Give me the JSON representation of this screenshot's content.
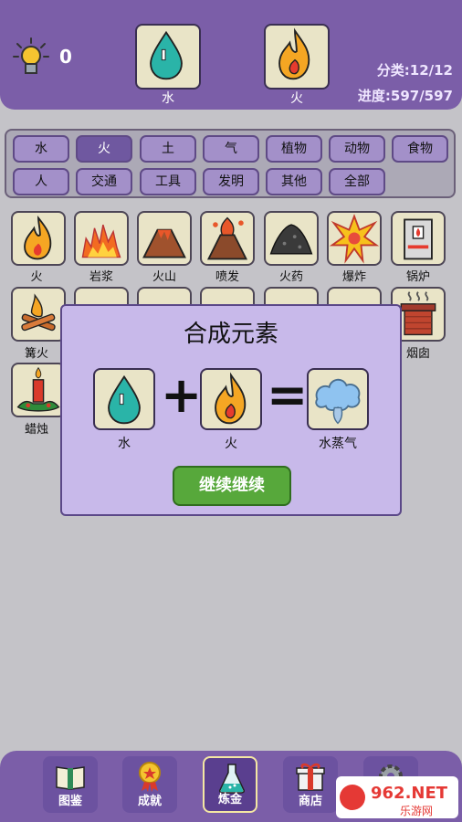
{
  "top": {
    "hint_count": "0",
    "slot_left_label": "水",
    "slot_right_label": "火",
    "category_stat": "分类:12/12",
    "progress_stat": "进度:597/597"
  },
  "categories": [
    "水",
    "火",
    "土",
    "气",
    "植物",
    "动物",
    "食物",
    "人",
    "交通",
    "工具",
    "发明",
    "其他",
    "全部"
  ],
  "elements": [
    "火",
    "岩浆",
    "火山",
    "喷发",
    "火药",
    "爆炸",
    "锅炉",
    "篝火",
    "",
    "",
    "",
    "",
    "",
    "烟囱",
    "蜡烛"
  ],
  "modal": {
    "title": "合成元素",
    "input_a": "水",
    "input_b": "火",
    "result": "水蒸气",
    "plus": "+",
    "equals": "=",
    "continue_label": "继续继续"
  },
  "nav": [
    "图鉴",
    "成就",
    "炼金",
    "商店",
    ""
  ],
  "watermark": {
    "brand": "962.NET",
    "subtitle": "乐游网"
  }
}
